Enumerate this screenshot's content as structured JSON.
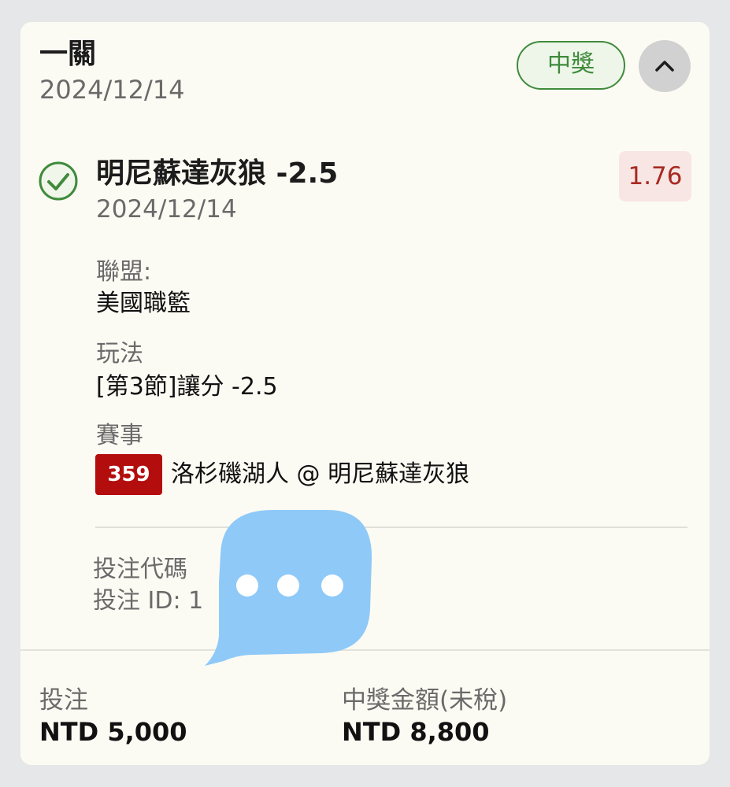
{
  "bet": {
    "type_title": "一關",
    "date": "2024/12/14",
    "status_label": "中獎"
  },
  "selection": {
    "name": "明尼蘇達灰狼 -2.5",
    "date": "2024/12/14",
    "odds": "1.76"
  },
  "details": {
    "league_label": "聯盟:",
    "league_value": "美國職籃",
    "market_label": "玩法",
    "market_value": "[第3節]讓分 -2.5",
    "event_label": "賽事",
    "event_number": "359",
    "event_name": "洛杉磯湖人 @ 明尼蘇達灰狼"
  },
  "meta": {
    "bet_code": "投注代碼",
    "bet_id": "投注 ID: 1"
  },
  "footer": {
    "stake_label": "投注",
    "stake_value": "NTD 5,000",
    "payout_label": "中獎金額(未稅)",
    "payout_value": "NTD 8,800"
  },
  "colors": {
    "win_green": "#3f8a3c",
    "odds_red": "#a82a22",
    "event_badge_red": "#b30d0d",
    "overlay_blue": "#8fc9f8"
  },
  "icons": {
    "status": "check-circle-icon",
    "collapse": "chevron-up-icon",
    "overlay": "chat-bubble-icon"
  }
}
